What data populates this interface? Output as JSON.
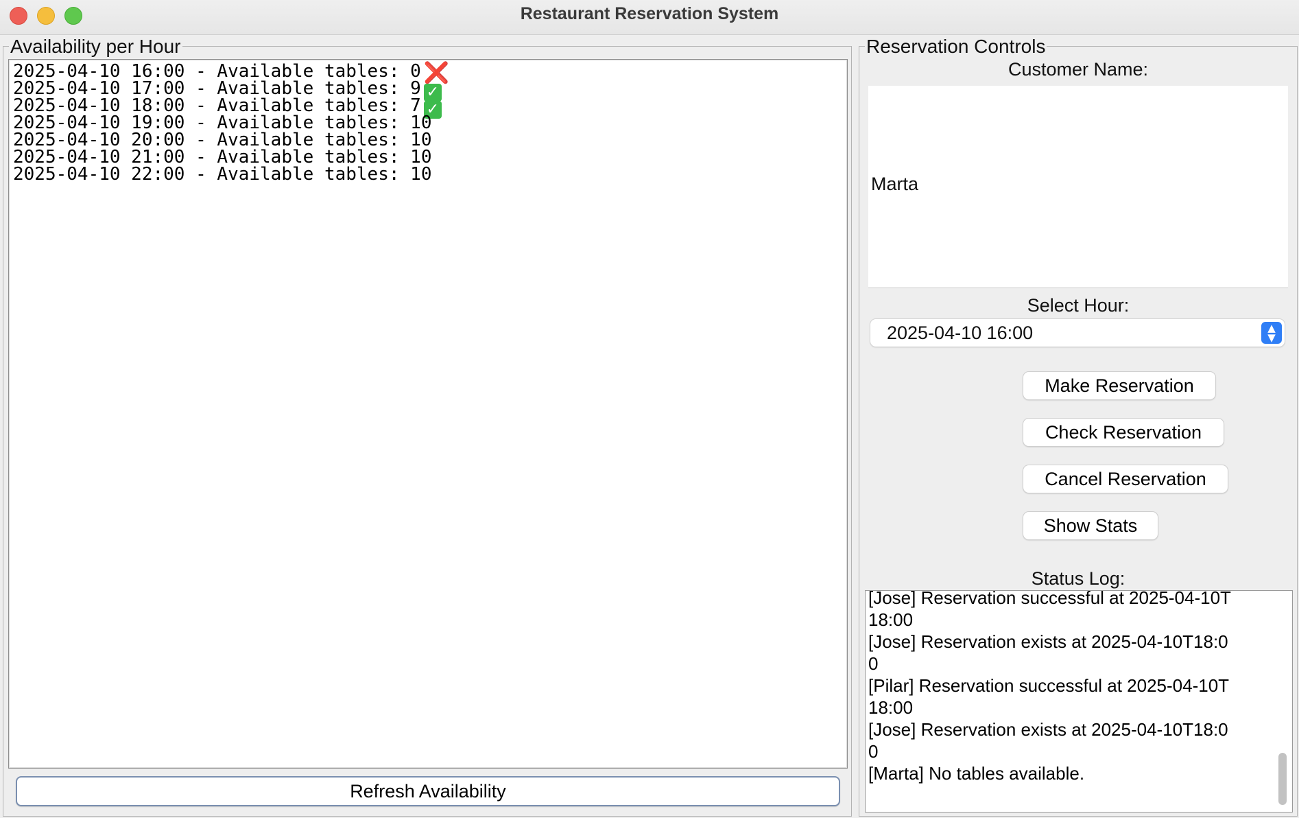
{
  "window": {
    "title": "Restaurant Reservation System"
  },
  "availability": {
    "legend": "Availability per Hour",
    "lines": [
      {
        "text": "2025-04-10 16:00 - Available tables: 0",
        "mark": "❌",
        "mark_type": "x"
      },
      {
        "text": "2025-04-10 17:00 - Available tables: 9",
        "mark": "✓",
        "mark_type": "ok"
      },
      {
        "text": "2025-04-10 18:00 - Available tables: 7",
        "mark": "✓",
        "mark_type": "ok"
      },
      {
        "text": "2025-04-10 19:00 - Available tables: 10",
        "mark": "",
        "mark_type": ""
      },
      {
        "text": "2025-04-10 20:00 - Available tables: 10",
        "mark": "",
        "mark_type": ""
      },
      {
        "text": "2025-04-10 21:00 - Available tables: 10",
        "mark": "",
        "mark_type": ""
      },
      {
        "text": "2025-04-10 22:00 - Available tables: 10",
        "mark": "",
        "mark_type": ""
      }
    ],
    "refresh_label": "Refresh Availability"
  },
  "controls": {
    "legend": "Reservation Controls",
    "customer_label": "Customer Name:",
    "customer_value": "Marta",
    "hour_label": "Select Hour:",
    "hour_value": "2025-04-10 16:00",
    "make_label": "Make Reservation",
    "check_label": "Check Reservation",
    "cancel_label": "Cancel Reservation",
    "stats_label": "Show Stats",
    "log_label": "Status Log:",
    "log_lines": [
      "[Jose] Reservation successful at 2025-04-10T",
      "18:00",
      "[Jose] Reservation exists at 2025-04-10T18:0",
      "0",
      "[Pilar] Reservation successful at 2025-04-10T",
      "18:00",
      "[Jose] Reservation exists at 2025-04-10T18:0",
      "0",
      "[Marta] No tables available."
    ]
  },
  "colors": {
    "select_accent": "#2f7ef6",
    "ok_mark": "#3dbb4c",
    "x_mark": "#e0302a"
  }
}
